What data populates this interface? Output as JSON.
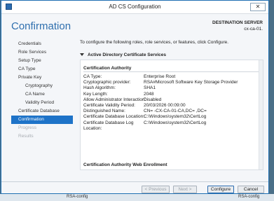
{
  "window": {
    "title": "AD CS Configuration",
    "close_glyph": "✕"
  },
  "page": {
    "heading": "Confirmation"
  },
  "destination": {
    "label": "DESTINATION SERVER",
    "server": "cx-ca-01."
  },
  "nav": {
    "items": [
      {
        "label": "Credentials",
        "state": "normal",
        "level": 0
      },
      {
        "label": "Role Services",
        "state": "normal",
        "level": 0
      },
      {
        "label": "Setup Type",
        "state": "normal",
        "level": 0
      },
      {
        "label": "CA Type",
        "state": "normal",
        "level": 0
      },
      {
        "label": "Private Key",
        "state": "normal",
        "level": 0
      },
      {
        "label": "Cryptography",
        "state": "normal",
        "level": 1
      },
      {
        "label": "CA Name",
        "state": "normal",
        "level": 1
      },
      {
        "label": "Validity Period",
        "state": "normal",
        "level": 1
      },
      {
        "label": "Certificate Database",
        "state": "normal",
        "level": 0
      },
      {
        "label": "Confirmation",
        "state": "active",
        "level": 0
      },
      {
        "label": "Progress",
        "state": "disabled",
        "level": 0
      },
      {
        "label": "Results",
        "state": "disabled",
        "level": 0
      }
    ]
  },
  "main": {
    "intro": "To configure the following roles, role services, or features, click Configure.",
    "section_title": "Active Directory Certificate Services",
    "ca_heading": "Certification Authority",
    "details": [
      {
        "key": "CA Type:",
        "value": "Enterprise Root"
      },
      {
        "key": "Cryptographic provider:",
        "value": "RSA#Microsoft Software Key Storage Provider"
      },
      {
        "key": "Hash Algorithm:",
        "value": "SHA1"
      },
      {
        "key": "Key Length:",
        "value": "2048"
      },
      {
        "key": "Allow Administrator Interaction:",
        "value": "Disabled"
      },
      {
        "key": "Certificate Validity Period:",
        "value": "20/03/2026 00:09:00"
      },
      {
        "key": "Distinguished Name:",
        "value": "CN=           -CX-CA-01-CA,DC=              ,DC="
      },
      {
        "key": "Certificate Database Location:",
        "value": "C:\\Windows\\system32\\CertLog"
      },
      {
        "key": "Certificate Database Log Location:",
        "value": "C:\\Windows\\system32\\CertLog"
      }
    ],
    "web_enrollment_heading": "Certification Authority Web Enrollment"
  },
  "buttons": {
    "previous": "< Previous",
    "next": "Next >",
    "configure": "Configure",
    "cancel": "Cancel"
  },
  "background": {
    "left_text": "RSA-config",
    "right_text": "RSA-config"
  }
}
